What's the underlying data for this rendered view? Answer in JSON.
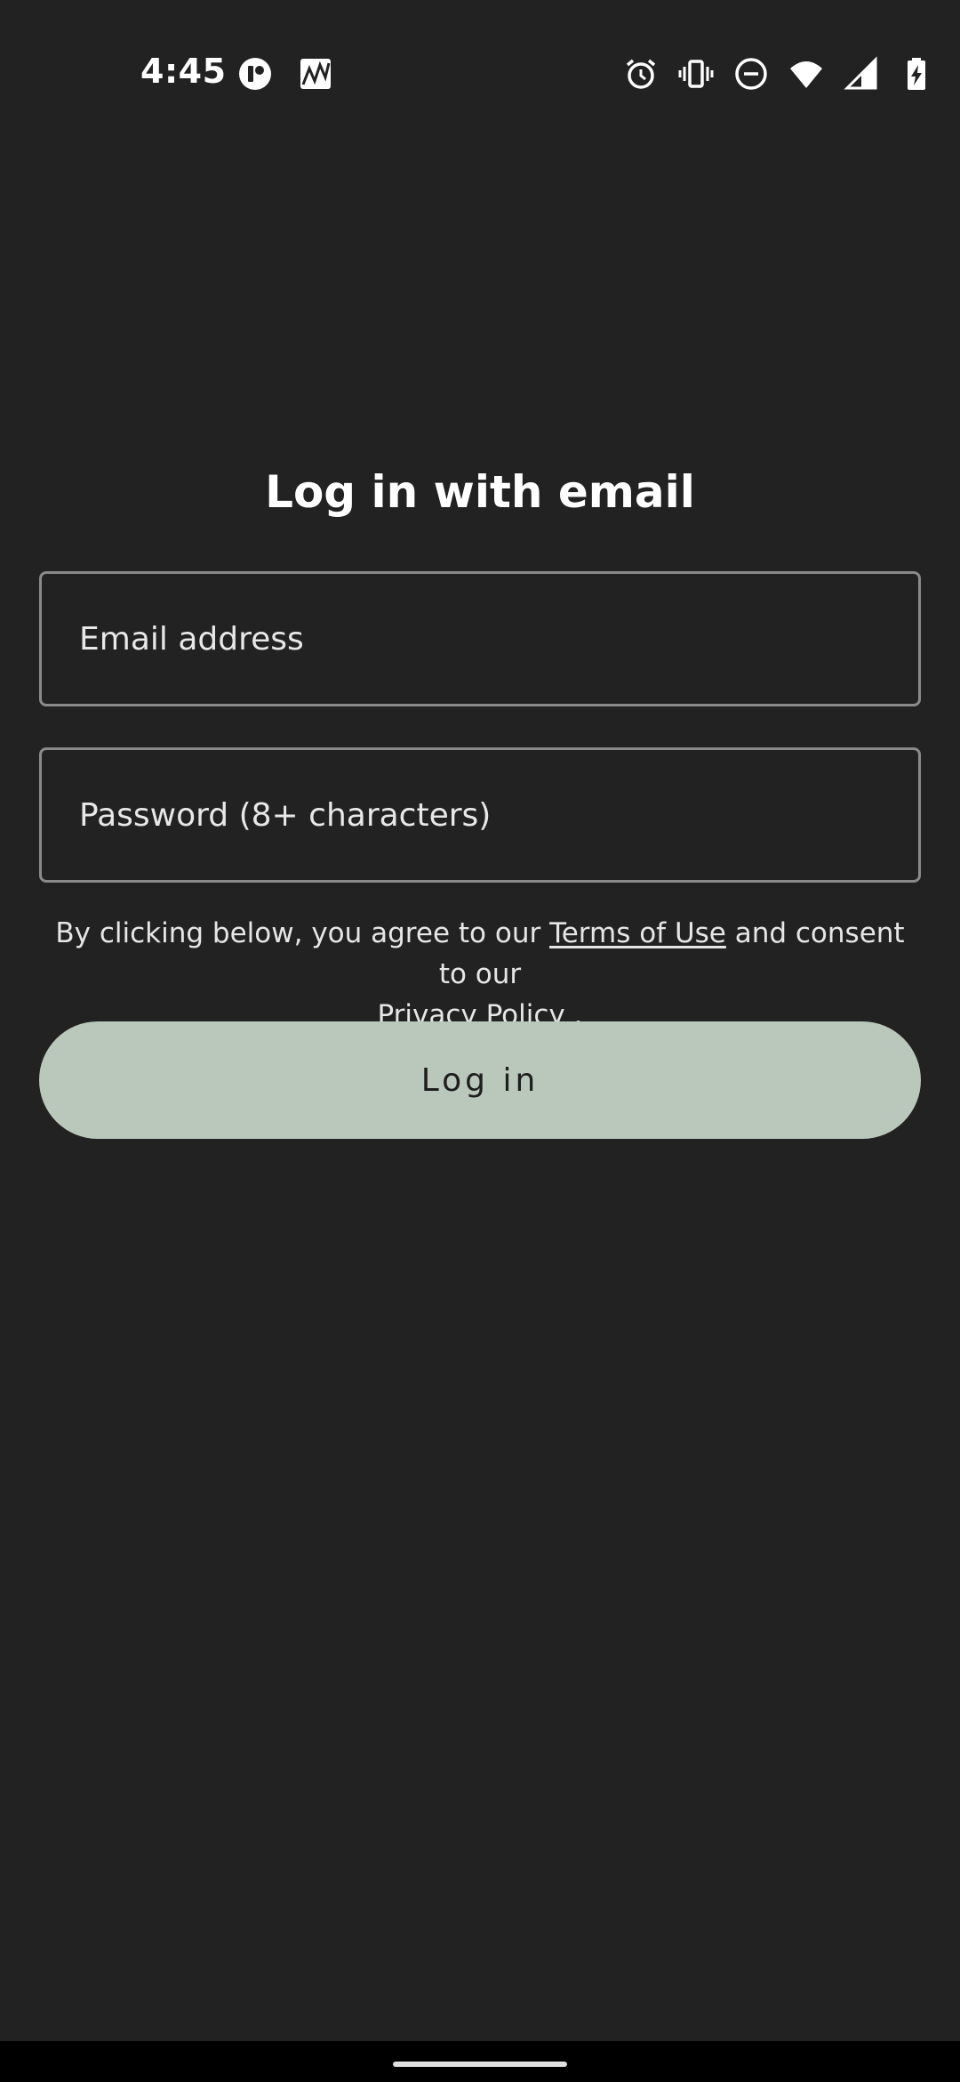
{
  "status_bar": {
    "time": "4:45",
    "left_icons": [
      "app-notification-icon",
      "stocks-notification-icon"
    ],
    "right_icons": [
      "alarm-icon",
      "vibrate-icon",
      "do-not-disturb-icon",
      "wifi-icon",
      "cellular-signal-icon",
      "battery-charging-icon"
    ]
  },
  "login": {
    "title": "Log in with email",
    "email_placeholder": "Email address",
    "password_placeholder": "Password (8+ characters)",
    "consent_prefix": "By clicking below, you agree to our ",
    "terms_link": "Terms of Use",
    "consent_middle": " and consent to our ",
    "privacy_link": "Privacy Policy",
    "consent_suffix": " .",
    "button_label": "Log in"
  },
  "colors": {
    "background": "#222222",
    "button_bg": "#bac8bb",
    "field_border": "#8a8a8a"
  }
}
